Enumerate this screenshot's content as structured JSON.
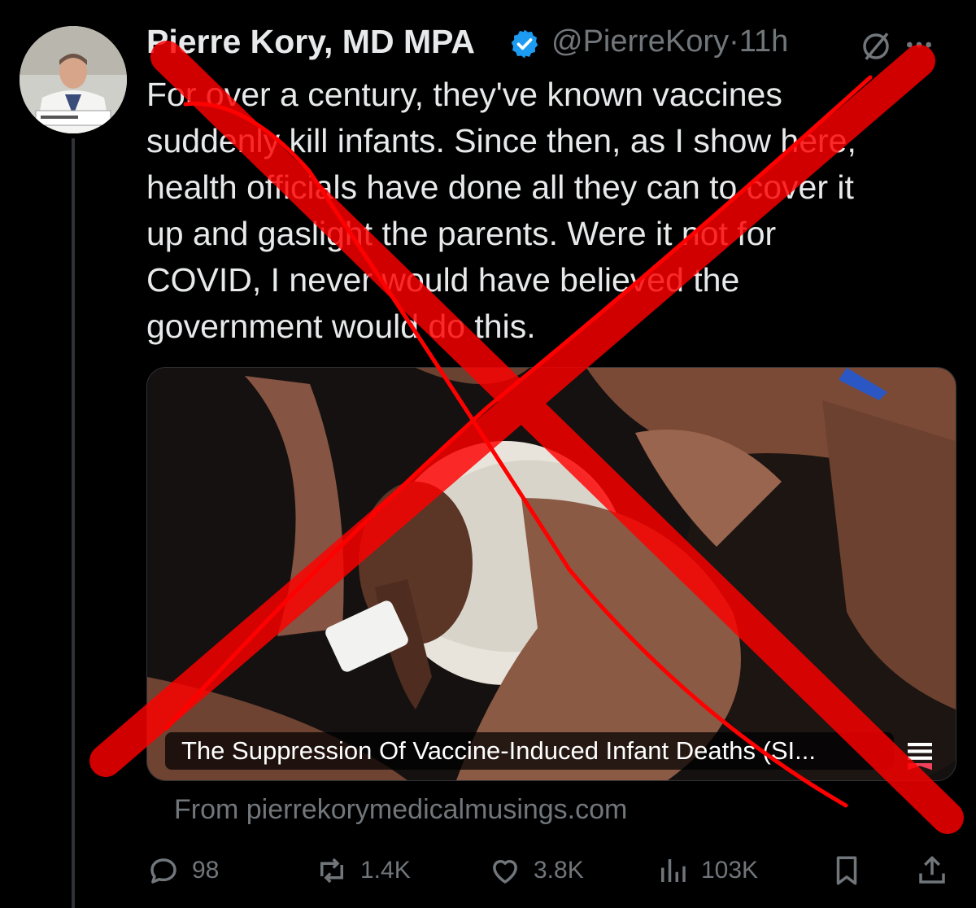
{
  "colors": {
    "background": "#000000",
    "text": "#e7e9ea",
    "muted": "#71767b",
    "verified": "#1d9bf0",
    "overlay_x": "#ff0000"
  },
  "author": {
    "name": "Pierre Kory, MD MPA",
    "handle": "@PierreKory",
    "separator": "·",
    "time": "11h",
    "verified_icon": "verified-badge-icon"
  },
  "tweet": {
    "text": "For over a century, they've known vaccines\nsuddenly kill infants. Since then, as I show here,\nhealth officials have done all they can to cover it\nup and gaslight the parents. Were it not for\nCOVID, I never would have believed the\ngovernment would do this."
  },
  "card": {
    "title": "The Suppression Of Vaccine-Induced Infant Deaths (SI...",
    "source": "From pierrekorymedicalmusings.com",
    "icon": "article-icon"
  },
  "actions": {
    "replies": "98",
    "reposts": "1.4K",
    "likes": "3.8K",
    "views": "103K"
  },
  "icons": [
    "grok-icon",
    "more-icon",
    "reply-icon",
    "repost-icon",
    "like-icon",
    "views-icon",
    "bookmark-icon",
    "share-icon"
  ]
}
